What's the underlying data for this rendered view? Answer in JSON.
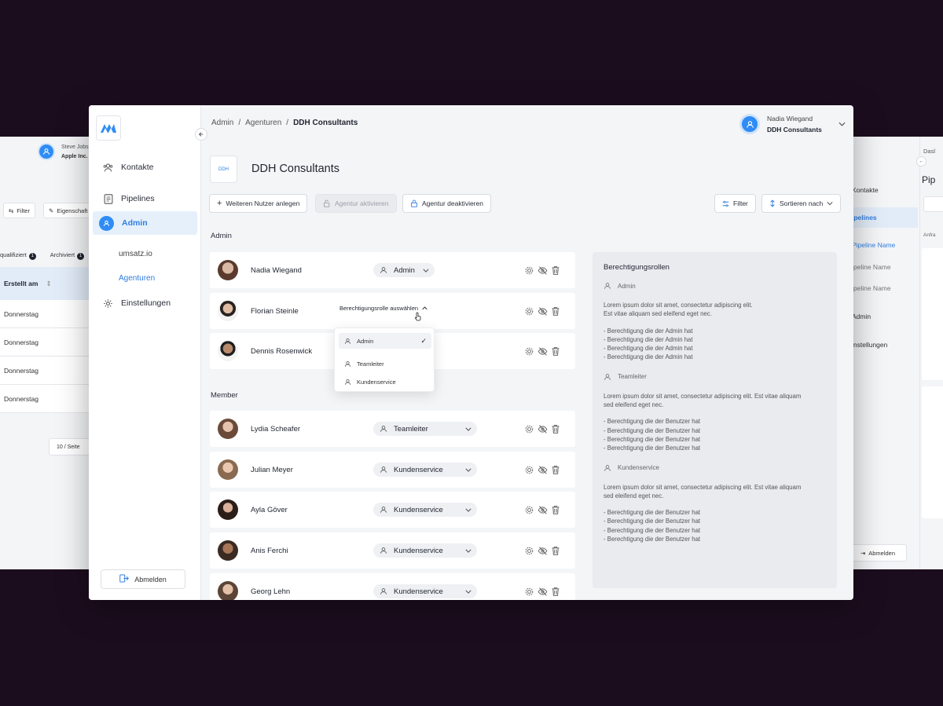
{
  "bg_left": {
    "user_name": "Steve Jobs",
    "user_company": "Apple Inc.",
    "filter_label": "Filter",
    "properties_label": "Eigenschaft",
    "tab_qualified": "qualifiziert",
    "tab_qualified_count": "1",
    "tab_archived": "Archiviert",
    "tab_archived_count": "1",
    "column_created": "Erstellt am",
    "rows": [
      "Donnerstag",
      "Donnerstag",
      "Donnerstag",
      "Donnerstag"
    ],
    "pagination": "10 / Seite"
  },
  "bg_right": {
    "nav_contacts": "Kontakte",
    "nav_pipelines": "ipelines",
    "nav_pipeline_name_active": "Pipeline Name",
    "nav_pipeline_name_2": "ipeline Name",
    "nav_pipeline_name_3": "ipeline Name",
    "nav_admin": "Admin",
    "nav_settings": "instellungen",
    "logout": "Abmelden",
    "crumb": "Dasl",
    "title": "Pip",
    "subtitle": "Anfra"
  },
  "sidebar": {
    "items": [
      {
        "label": "Kontakte",
        "icon": "users-icon"
      },
      {
        "label": "Pipelines",
        "icon": "document-icon"
      },
      {
        "label": "Admin",
        "icon": "user-icon"
      }
    ],
    "sub_items": [
      {
        "label": "umsatz.io"
      },
      {
        "label": "Agenturen"
      }
    ],
    "settings": {
      "label": "Einstellungen",
      "icon": "gear-icon"
    },
    "logout": "Abmelden"
  },
  "breadcrumb": {
    "items": [
      "Admin",
      "Agenturen",
      "DDH Consultants"
    ],
    "separator": "/"
  },
  "user": {
    "name": "Nadia Wiegand",
    "company": "DDH Consultants"
  },
  "company": {
    "logo_text": "DDH",
    "title": "DDH Consultants"
  },
  "toolbar": {
    "add_user": "Weiteren Nutzer anlegen",
    "activate": "Agentur aktivieren",
    "deactivate": "Agentur deaktivieren",
    "filter": "Filter",
    "sort": "Sortieren nach"
  },
  "sections": {
    "admin": "Admin",
    "member": "Member"
  },
  "admins": [
    {
      "name": "Nadia Wiegand",
      "role": "Admin"
    },
    {
      "name": "Florian Steinle",
      "role": ""
    },
    {
      "name": "Dennis Rosenwick",
      "role": ""
    }
  ],
  "members": [
    {
      "name": "Lydia Scheafer",
      "role": "Teamleiter"
    },
    {
      "name": "Julian Meyer",
      "role": "Kundenservice"
    },
    {
      "name": "Ayla Göver",
      "role": "Kundenservice"
    },
    {
      "name": "Anis Ferchi",
      "role": "Kundenservice"
    },
    {
      "name": "Georg Lehn",
      "role": "Kundenservice"
    }
  ],
  "role_dropdown": {
    "header": "Berechtigungsrolle auswählen",
    "options": [
      "Admin",
      "Teamleiter",
      "Kundenservice"
    ],
    "selected": "Admin"
  },
  "permissions": {
    "title": "Berechtigungsrollen",
    "roles": [
      {
        "name": "Admin",
        "desc_1": "Lorem ipsum dolor sit amet, consectetur adipiscing elit.",
        "desc_2": "Est vitae aliquam sed eleifend eget nec.",
        "items": [
          "- Berechtigung die der Admin hat",
          "- Berechtigung die der Admin hat",
          "- Berechtigung die der Admin hat",
          "- Berechtigung die der Admin hat"
        ]
      },
      {
        "name": "Teamleiter",
        "desc_1": "Lorem ipsum dolor sit amet, consectetur adipiscing elit. Est vitae aliquam",
        "desc_2": "sed eleifend eget nec.",
        "items": [
          "- Berechtigung die der Benutzer hat",
          "- Berechtigung die der Benutzer hat",
          "- Berechtigung die der Benutzer hat",
          "- Berechtigung die der Benutzer hat"
        ]
      },
      {
        "name": "Kundenservice",
        "desc_1": "Lorem ipsum dolor sit amet, consectetur adipiscing elit. Est vitae aliquam",
        "desc_2": "sed eleifend eget nec.",
        "items": [
          "- Berechtigung die der Benutzer hat",
          "- Berechtigung die der Benutzer hat",
          "- Berechtigung die der Benutzer hat",
          "- Berechtigung die der Benutzer hat"
        ]
      }
    ]
  },
  "colors": {
    "accent": "#2f7ee0",
    "background": "#1c0d1e",
    "panel": "#f4f5f7"
  }
}
